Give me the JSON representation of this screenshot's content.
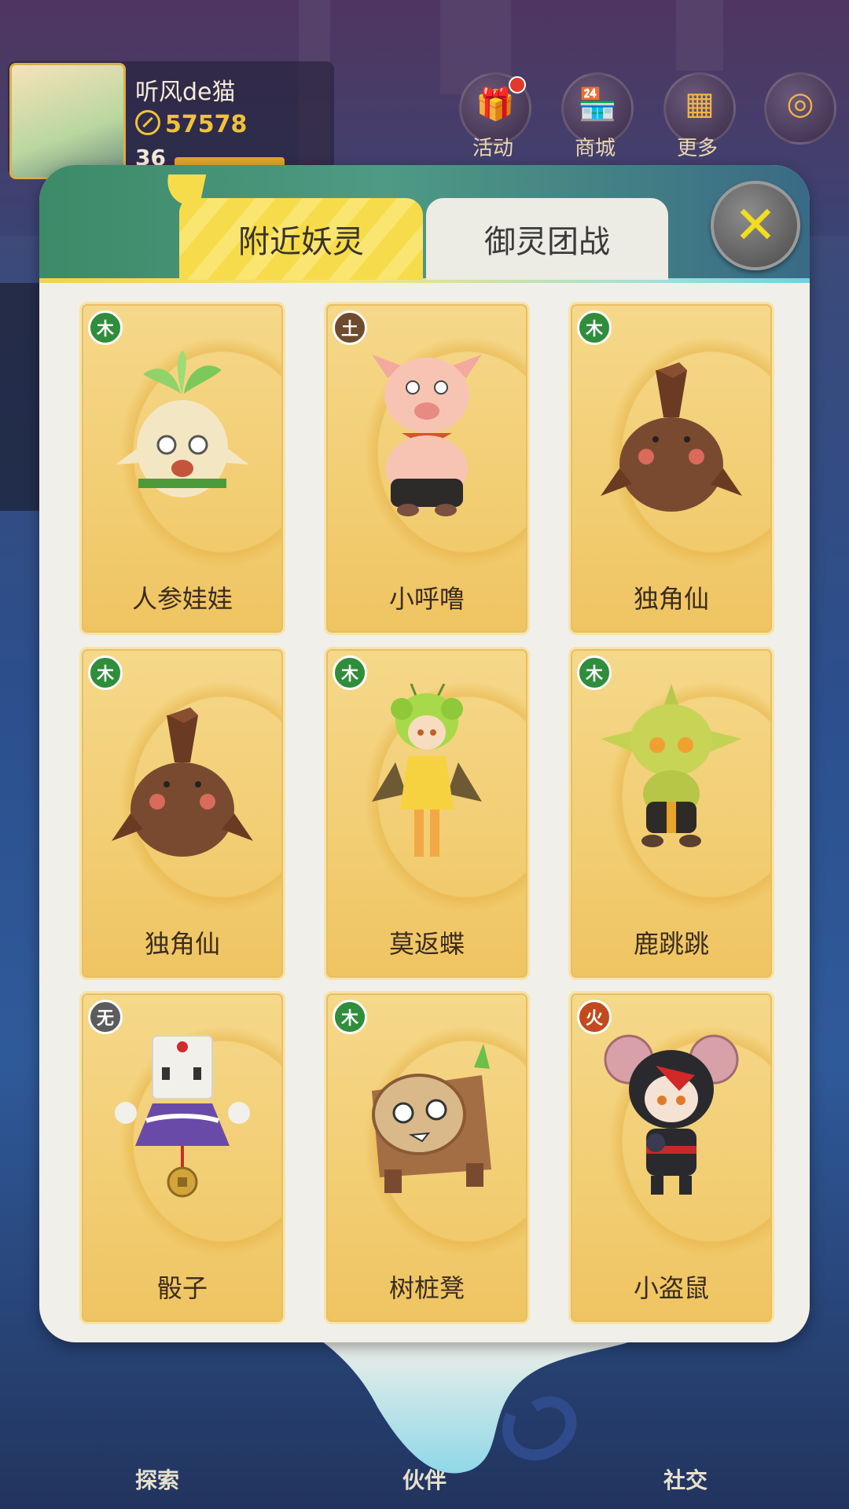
{
  "hud": {
    "player_name": "听风de猫",
    "power": "57578",
    "level": "36",
    "buttons": [
      {
        "label": "活动",
        "icon": "gift-icon",
        "has_badge": true
      },
      {
        "label": "商城",
        "icon": "shop-icon",
        "has_badge": false
      },
      {
        "label": "更多",
        "icon": "grid-icon",
        "has_badge": false
      },
      {
        "label": "",
        "icon": "compass-icon",
        "has_badge": false
      }
    ],
    "bottom_nav": [
      "探索",
      "伙伴",
      "社交"
    ]
  },
  "dialog": {
    "tabs": [
      {
        "label": "附近妖灵",
        "active": true
      },
      {
        "label": "御灵团战",
        "active": false
      }
    ],
    "close_glyph": "✕"
  },
  "spirits": [
    {
      "name": "人参娃娃",
      "element": "木",
      "element_type": "wood",
      "creature": "ginseng"
    },
    {
      "name": "小呼噜",
      "element": "土",
      "element_type": "earth",
      "creature": "pig"
    },
    {
      "name": "独角仙",
      "element": "木",
      "element_type": "wood",
      "creature": "beetle"
    },
    {
      "name": "独角仙",
      "element": "木",
      "element_type": "wood",
      "creature": "beetle"
    },
    {
      "name": "莫返蝶",
      "element": "木",
      "element_type": "wood",
      "creature": "butterfly-girl"
    },
    {
      "name": "鹿跳跳",
      "element": "木",
      "element_type": "wood",
      "creature": "goblin"
    },
    {
      "name": "骰子",
      "element": "无",
      "element_type": "none",
      "creature": "dice"
    },
    {
      "name": "树桩凳",
      "element": "木",
      "element_type": "wood",
      "creature": "stump"
    },
    {
      "name": "小盗鼠",
      "element": "火",
      "element_type": "fire",
      "creature": "mouse"
    }
  ],
  "colors": {
    "card_gold": "#f2cd72",
    "tab_active": "#f6dc4a",
    "close_x": "#f4dc1e",
    "wood": "#2f8d3c",
    "earth": "#6e4a2e",
    "none": "#5c5c5c",
    "fire": "#c24a1e"
  }
}
